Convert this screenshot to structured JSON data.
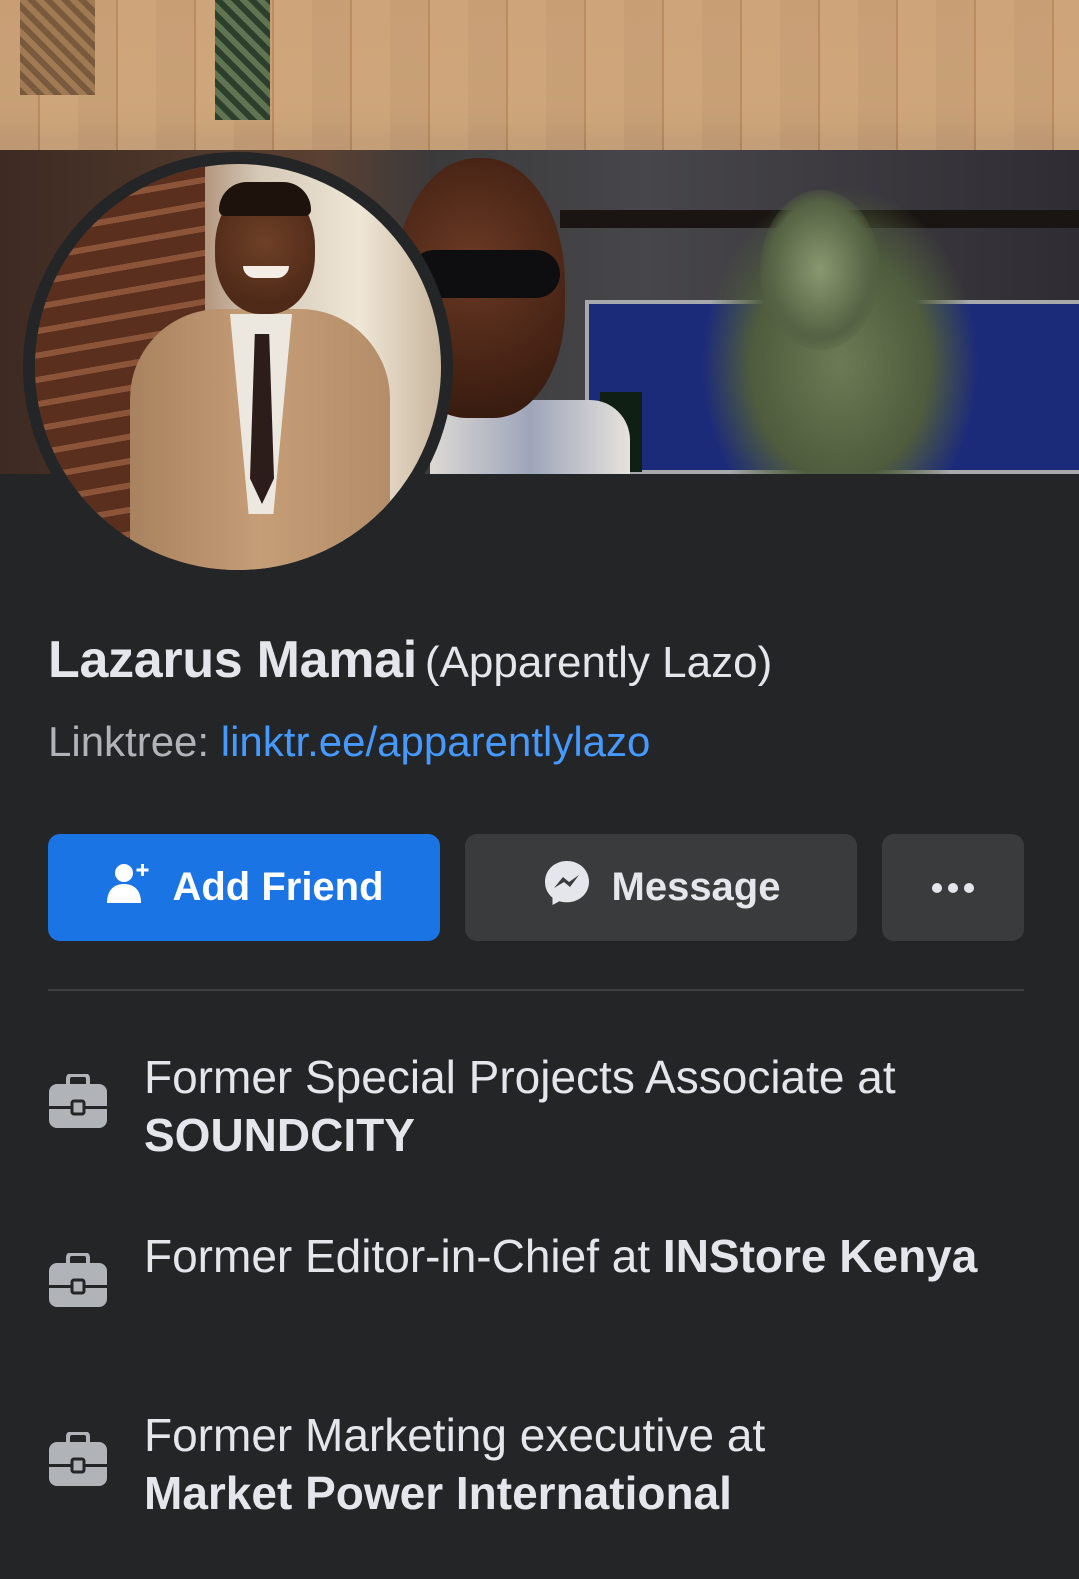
{
  "profile": {
    "name": "Lazarus Mamai",
    "alternate_name": "(Apparently Lazo)",
    "bio_label": "Linktree:",
    "bio_link": "linktr.ee/apparentlylazo"
  },
  "actions": {
    "add_friend_label": "Add Friend",
    "message_label": "Message",
    "more_icon": "more-dots-icon"
  },
  "work": [
    {
      "prefix": "Former Special Projects Associate at",
      "company": "SOUNDCITY",
      "icon": "briefcase-icon"
    },
    {
      "prefix": "Former Editor-in-Chief at",
      "company": "INStore Kenya",
      "icon": "briefcase-icon"
    },
    {
      "prefix": "Former Marketing executive at",
      "company": "Market Power International",
      "icon": "briefcase-icon"
    }
  ],
  "colors": {
    "background": "#242526",
    "primary_button": "#1b74e4",
    "secondary_button": "#3a3b3c",
    "link": "#4599ff",
    "text_primary": "#e4e6eb",
    "text_secondary": "#b0b3b8"
  }
}
